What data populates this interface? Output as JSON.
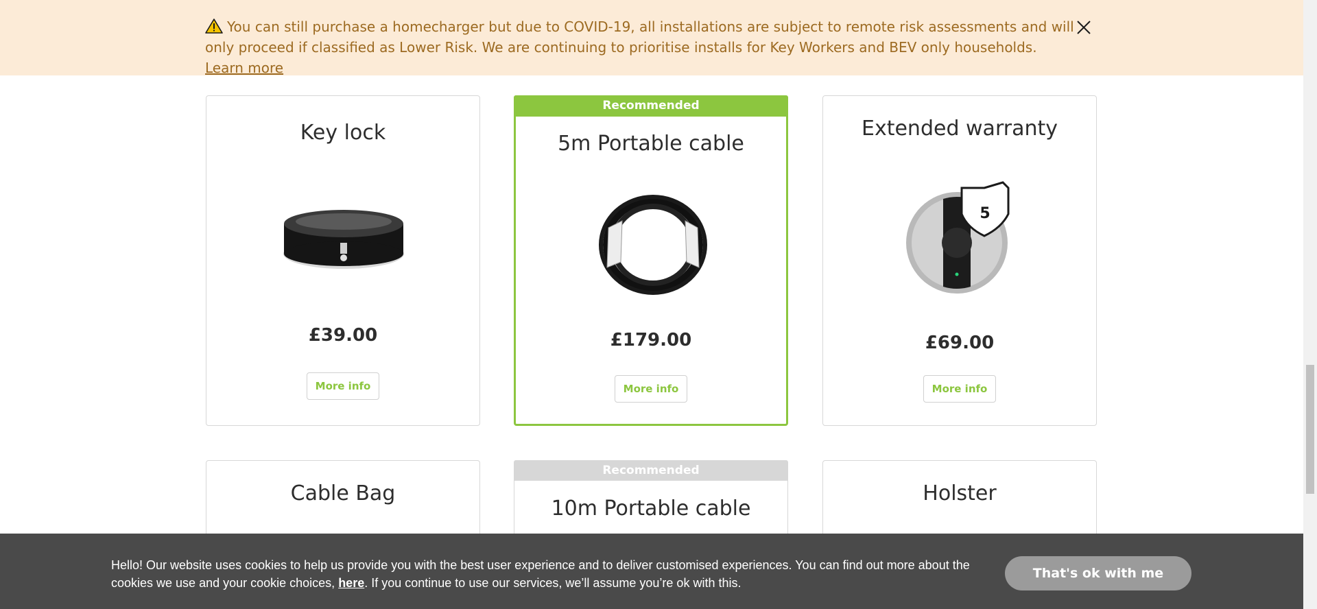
{
  "alert": {
    "message": "You can still purchase a homecharger but due to COVID-19, all installations are subject to remote risk assessments and will only proceed if classified as Lower Risk. We are continuing to prioritise installs for Key Workers and BEV only households.",
    "link_text": "Learn more",
    "icon": "warning-icon",
    "close_icon": "close-icon"
  },
  "products": [
    {
      "title": "Key lock",
      "price": "£39.00",
      "button": "More info",
      "recommended": false
    },
    {
      "title": "5m Portable cable",
      "price": "£179.00",
      "button": "More info",
      "recommended": true,
      "badge": "Recommended"
    },
    {
      "title": "Extended warranty",
      "price": "£69.00",
      "button": "More info",
      "recommended": false,
      "shield_number": "5"
    },
    {
      "title": "Cable Bag",
      "recommended": false
    },
    {
      "title": "10m Portable cable",
      "recommended": true,
      "badge": "Recommended"
    },
    {
      "title": "Holster",
      "recommended": false
    }
  ],
  "cookie": {
    "text_before": "Hello! Our website uses cookies to help us provide you with the best user experience and to deliver customised experiences. You can find out more about the cookies we use and your cookie choices, ",
    "link_text": "here",
    "text_after": ". If you continue to use our services, we’ll assume you’re ok with this.",
    "button": "That's ok with me"
  },
  "colors": {
    "accent": "#8cc63f",
    "alert_bg": "#fcebd7",
    "alert_text": "#9c6a21",
    "cookie_bg": "#4a4a4a"
  }
}
